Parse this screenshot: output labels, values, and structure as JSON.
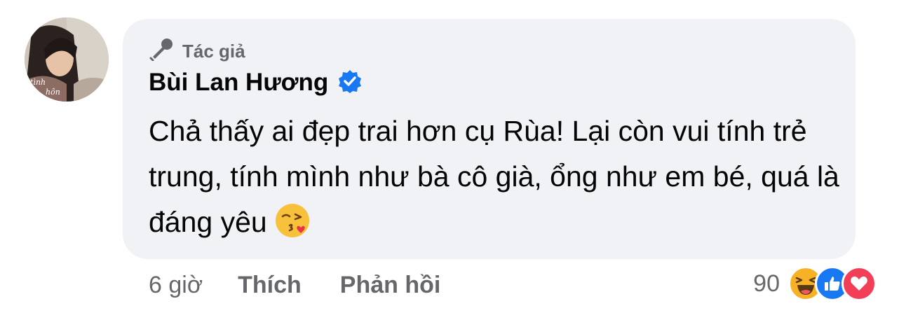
{
  "comment": {
    "badge_label": "Tác giả",
    "author_name": "Bùi Lan Hương",
    "verified": true,
    "text": "Chả thấy ai đẹp trai hơn cụ Rùa! Lại còn vui tính trẻ trung, tính mình như bà cô già, ổng như em bé, quá là đáng yêu",
    "trailing_emoji": "face-blowing-kiss-icon"
  },
  "actions": {
    "time": "6 giờ",
    "like_label": "Thích",
    "reply_label": "Phản hồi"
  },
  "reactions": {
    "count": "90",
    "types": [
      "haha-icon",
      "like-icon",
      "love-icon"
    ]
  },
  "colors": {
    "bubble": "#f0f2f5",
    "secondary_text": "#65676b",
    "primary_text": "#050505",
    "like_blue": "#1877f2",
    "love_red": "#f33e58",
    "haha_yellow": "#f7b125"
  }
}
